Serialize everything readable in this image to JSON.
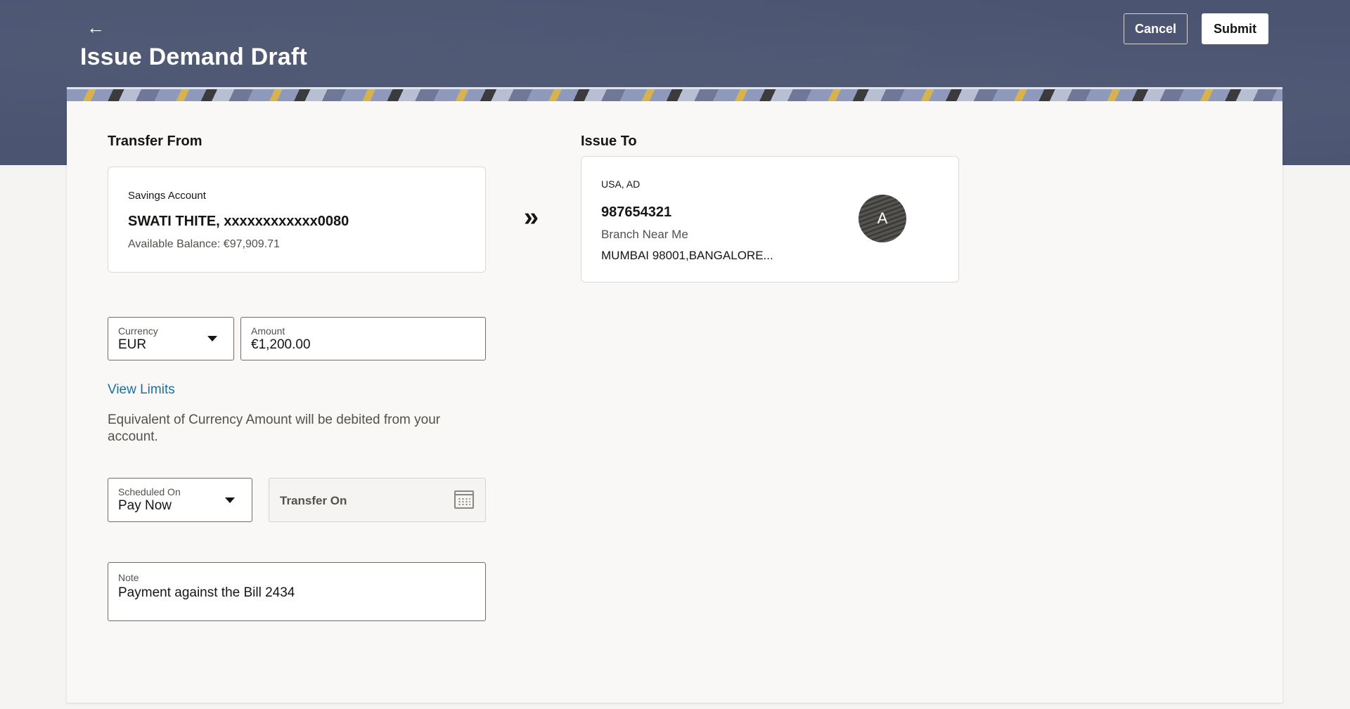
{
  "header": {
    "back_icon": "arrow-left-icon",
    "title": "Issue Demand Draft",
    "cancel_label": "Cancel",
    "submit_label": "Submit"
  },
  "transfer_from": {
    "section_label": "Transfer From",
    "account_type": "Savings Account",
    "account_name": "SWATI THITE, xxxxxxxxxxxx0080",
    "available_balance": "Available Balance: €97,909.71"
  },
  "issue_to": {
    "section_label": "Issue To",
    "country": "USA, AD",
    "account_number": "987654321",
    "branch": "Branch Near Me",
    "address": "MUMBAI 98001,BANGALORE...",
    "avatar_initial": "A"
  },
  "form": {
    "currency": {
      "label": "Currency",
      "value": "EUR"
    },
    "amount": {
      "label": "Amount",
      "value": "€1,200.00"
    },
    "view_limits": "View Limits",
    "equivalent_note": "Equivalent of Currency Amount will be debited from your account.",
    "scheduled_on": {
      "label": "Scheduled On",
      "value": "Pay Now"
    },
    "transfer_on": {
      "placeholder": "Transfer On"
    },
    "note": {
      "label": "Note",
      "value": "Payment against the Bill 2434"
    }
  },
  "colors": {
    "header_bg": "#4b5571",
    "link": "#1c6fa6",
    "page_bg": "#f5f4f2"
  }
}
